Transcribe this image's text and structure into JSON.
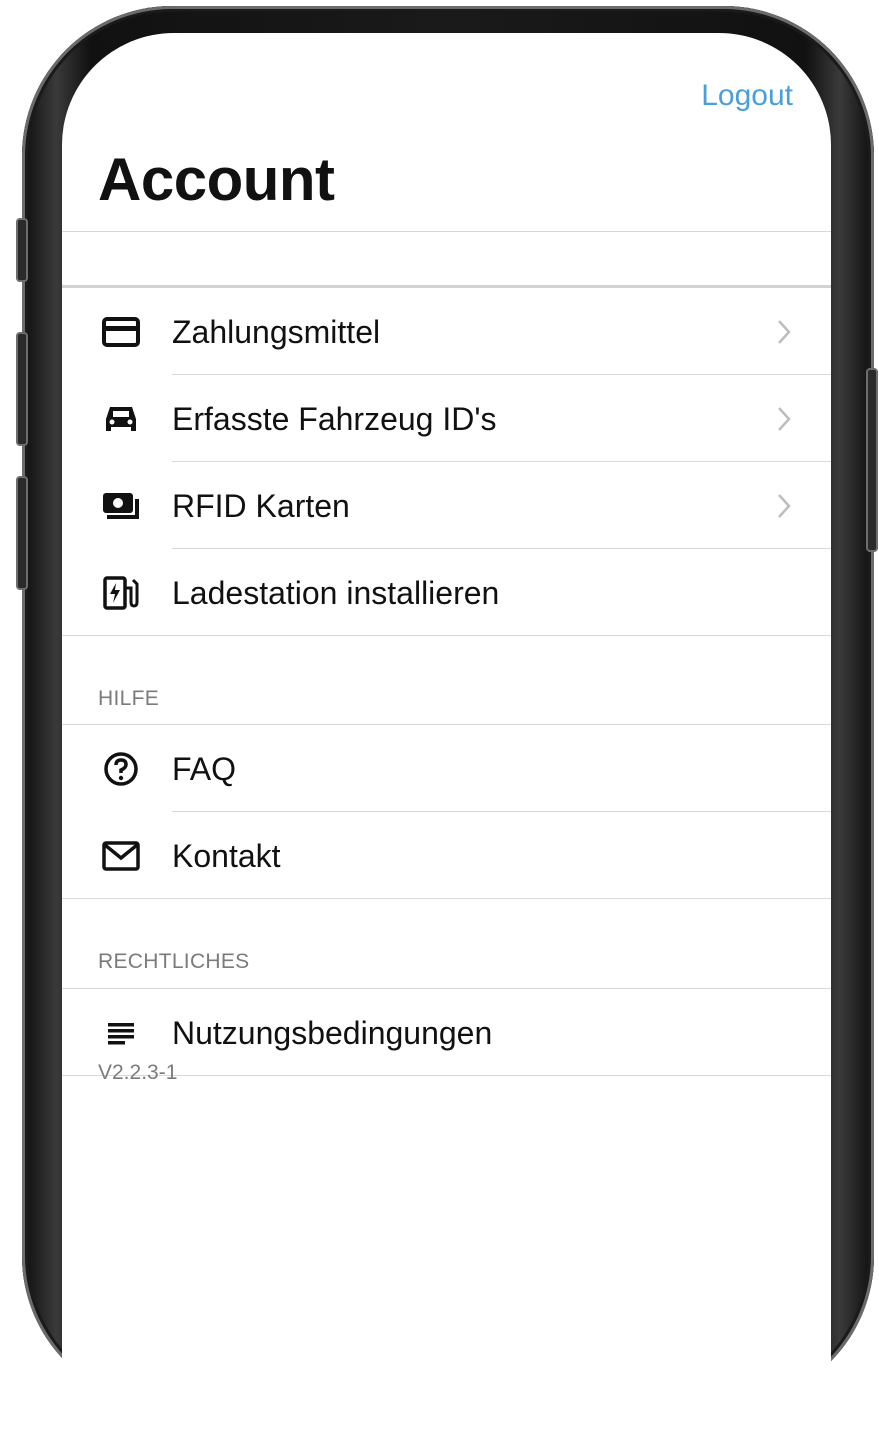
{
  "header": {
    "logout_label": "Logout",
    "title": "Account"
  },
  "colors": {
    "accent": "#4a9fd8",
    "text": "#111111",
    "muted": "#7b7b7b",
    "divider": "#d8d8d8"
  },
  "account_items": [
    {
      "label": "Zahlungsmittel",
      "icon": "credit-card-icon",
      "chevron": true
    },
    {
      "label": "Erfasste Fahrzeug ID's",
      "icon": "car-icon",
      "chevron": true
    },
    {
      "label": "RFID Karten",
      "icon": "rfid-card-icon",
      "chevron": true
    },
    {
      "label": "Ladestation installieren",
      "icon": "charging-station-icon",
      "chevron": false
    }
  ],
  "help_section": {
    "header": "HILFE",
    "items": [
      {
        "label": "FAQ",
        "icon": "question-circle-icon"
      },
      {
        "label": "Kontakt",
        "icon": "envelope-icon"
      }
    ]
  },
  "legal_section": {
    "header": "RECHTLICHES",
    "items": [
      {
        "label": "Nutzungsbedingungen",
        "icon": "document-lines-icon"
      }
    ]
  },
  "footer": {
    "version": "V2.2.3-1"
  }
}
